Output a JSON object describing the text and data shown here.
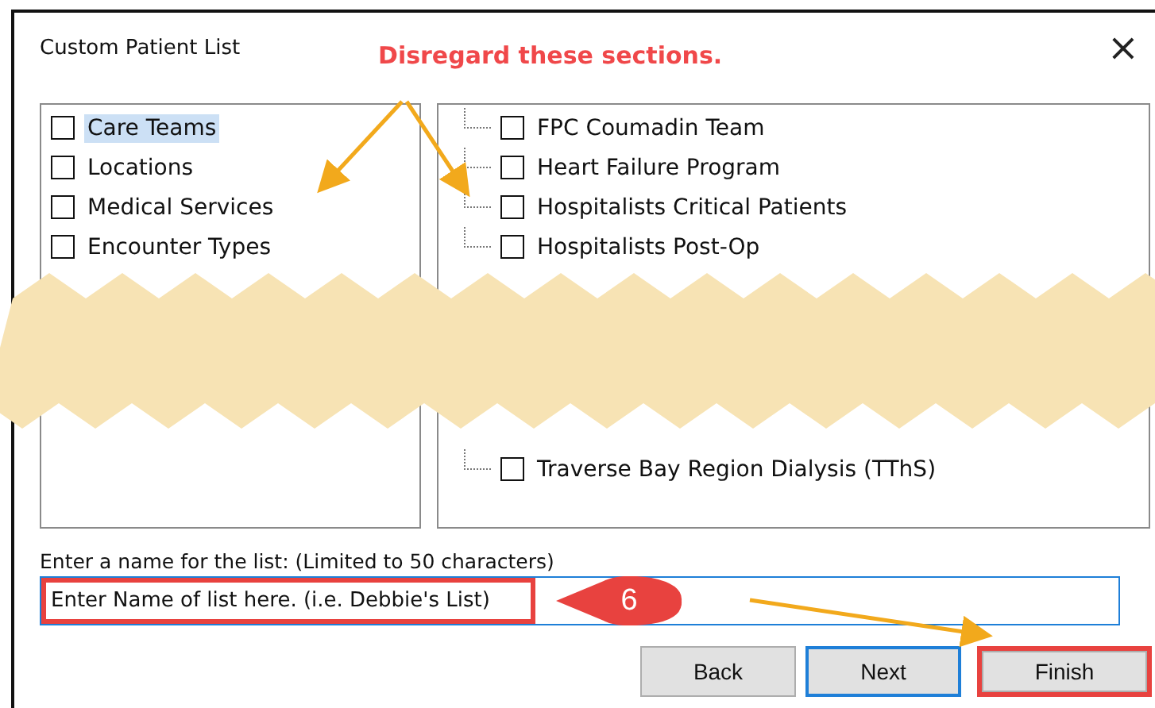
{
  "window": {
    "title": "Custom Patient List",
    "close": "×"
  },
  "annotation": {
    "text": "Disregard these sections."
  },
  "left_list": {
    "items": [
      {
        "label": "Care Teams",
        "checked": false,
        "selected": true
      },
      {
        "label": "Locations",
        "checked": false,
        "selected": false
      },
      {
        "label": "Medical Services",
        "checked": false,
        "selected": false
      },
      {
        "label": "Encounter Types",
        "checked": false,
        "selected": false
      }
    ]
  },
  "right_list": {
    "upper_items": [
      {
        "label": "FPC Coumadin Team",
        "checked": false
      },
      {
        "label": "Heart Failure Program",
        "checked": false
      },
      {
        "label": "Hospitalists Critical Patients",
        "checked": false
      },
      {
        "label": "Hospitalists Post-Op",
        "checked": false
      }
    ],
    "lower_items": [
      {
        "label": "Traverse Bay Region Dialysis (TThS)",
        "checked": false
      }
    ]
  },
  "name_field": {
    "label": "Enter a name for the list: (Limited to 50 characters)",
    "value": "Enter Name of list here. (i.e. Debbie's List)",
    "highlighted": true
  },
  "callout": {
    "number": "6"
  },
  "buttons": [
    {
      "label": "Back",
      "focused": false,
      "highlighted": false
    },
    {
      "label": "Next",
      "focused": true,
      "highlighted": false
    },
    {
      "label": "Finish",
      "focused": false,
      "highlighted": true
    }
  ]
}
